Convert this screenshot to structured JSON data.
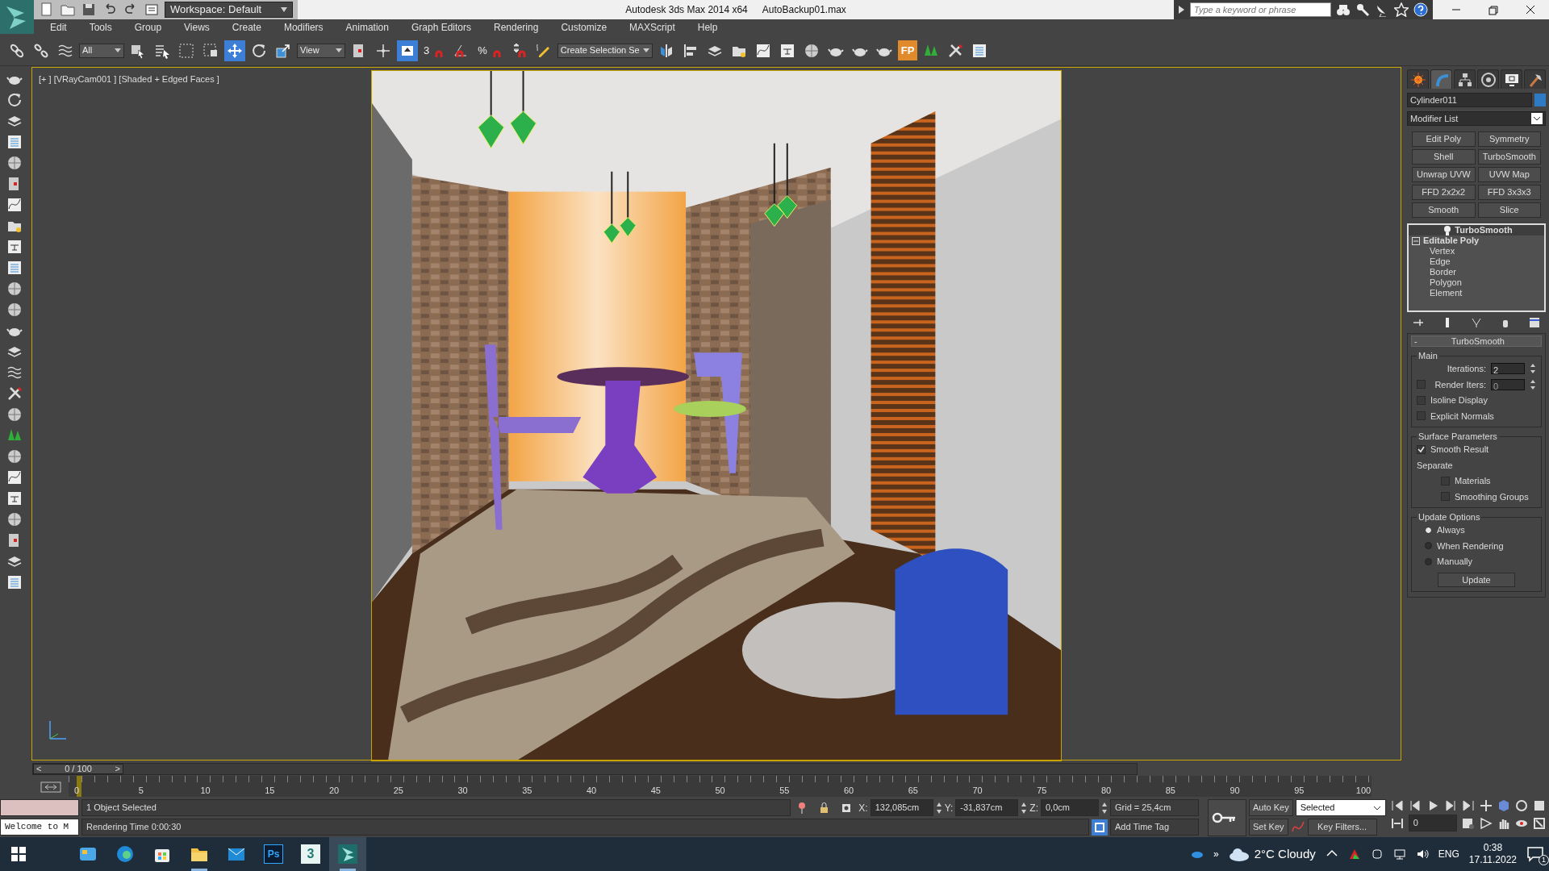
{
  "title_bar": {
    "workspace": "Workspace: Default",
    "app_title": "Autodesk 3ds Max  2014 x64",
    "file_name": "AutoBackup01.max",
    "search": {
      "placeholder": "Type a keyword or phrase"
    }
  },
  "menu": [
    "Edit",
    "Tools",
    "Group",
    "Views",
    "Create",
    "Modifiers",
    "Animation",
    "Graph Editors",
    "Rendering",
    "Customize",
    "MAXScript",
    "Help"
  ],
  "main_toolbar": [
    {
      "kind": "chain",
      "selected": false
    },
    {
      "kind": "broken-chain",
      "selected": false
    },
    {
      "kind": "wave",
      "selected": false
    },
    {
      "kind": "dropdown",
      "value": "All"
    },
    {
      "kind": "cube-cursor",
      "selected": false
    },
    {
      "kind": "list-cursor",
      "selected": false
    },
    {
      "kind": "dashed-rect",
      "selected": false
    },
    {
      "kind": "dashed-cube",
      "selected": false
    },
    {
      "kind": "move",
      "selected": true
    },
    {
      "kind": "rotate",
      "selected": false
    },
    {
      "kind": "scale",
      "selected": false
    },
    {
      "kind": "dropdown",
      "value": "View"
    },
    {
      "kind": "pivot",
      "selected": false
    },
    {
      "kind": "axis-cross",
      "selected": false
    },
    {
      "kind": "manipulate",
      "selected": true
    },
    {
      "kind": "magnet",
      "label": "3",
      "selected": false
    },
    {
      "kind": "angle-magnet",
      "selected": false
    },
    {
      "kind": "magnet",
      "label": "%",
      "selected": false
    },
    {
      "kind": "spinner-magnet",
      "selected": false
    },
    {
      "kind": "pencil",
      "selected": false
    },
    {
      "kind": "dropdown",
      "value": "Create Selection Se"
    },
    {
      "kind": "mirror",
      "selected": false
    },
    {
      "kind": "align",
      "selected": false
    },
    {
      "kind": "layers",
      "selected": false
    },
    {
      "kind": "folder",
      "selected": false
    },
    {
      "kind": "curve",
      "selected": false
    },
    {
      "kind": "schematic",
      "selected": false
    },
    {
      "kind": "sphere",
      "selected": false
    },
    {
      "kind": "teapot",
      "selected": false
    },
    {
      "kind": "teapot",
      "selected": false
    },
    {
      "kind": "teapot",
      "selected": false
    },
    {
      "kind": "badge",
      "label": "FP",
      "selected": false
    },
    {
      "kind": "trees",
      "selected": false
    },
    {
      "kind": "tools",
      "selected": false
    },
    {
      "kind": "list",
      "selected": false
    }
  ],
  "viewport": {
    "label": "[+ ] [VRayCam001 ] [Shaded + Edged Faces ]",
    "active": true
  },
  "command_panel": {
    "tabs": [
      {
        "kind": "create",
        "selected": false
      },
      {
        "kind": "modify",
        "selected": true
      },
      {
        "kind": "hierarchy",
        "selected": false
      },
      {
        "kind": "motion",
        "selected": false
      },
      {
        "kind": "display",
        "selected": false
      },
      {
        "kind": "utilities",
        "selected": false
      }
    ],
    "object_name": "Cylinder011",
    "modifier_list": "Modifier List",
    "modifier_buttons": [
      "Edit Poly",
      "Symmetry",
      "Shell",
      "TurboSmooth",
      "Unwrap UVW",
      "UVW Map",
      "FFD 2x2x2",
      "FFD 3x3x3",
      "Smooth",
      "Slice"
    ],
    "stack": [
      {
        "kind": "modifier",
        "label": "TurboSmooth",
        "selected": true
      },
      {
        "kind": "object",
        "label": "Editable Poly",
        "selected": false,
        "expanded": true,
        "children": [
          {
            "label": "Vertex"
          },
          {
            "label": "Edge"
          },
          {
            "label": "Border"
          },
          {
            "label": "Polygon"
          },
          {
            "label": "Element"
          }
        ]
      }
    ],
    "rollout": {
      "toggle": "-",
      "title": "TurboSmooth",
      "groups": [
        {
          "title": "Main",
          "controls": [
            {
              "kind": "spinner",
              "label": "Iterations:",
              "value": "2"
            },
            {
              "kind": "check-spinner",
              "label": "Render Iters:",
              "checked": false,
              "value": "0"
            },
            {
              "kind": "checkbox",
              "label": "Isoline Display",
              "checked": false
            },
            {
              "kind": "checkbox",
              "label": "Explicit Normals",
              "checked": false
            }
          ]
        },
        {
          "title": "Surface Parameters",
          "controls": [
            {
              "kind": "checkbox",
              "label": "Smooth Result",
              "checked": true
            },
            {
              "kind": "text",
              "label": "Separate"
            },
            {
              "kind": "sub-checkbox",
              "label": "Materials",
              "checked": false
            },
            {
              "kind": "sub-checkbox",
              "label": "Smoothing Groups",
              "checked": false
            }
          ]
        },
        {
          "title": "Update Options",
          "controls": [
            {
              "kind": "radio",
              "label": "Always",
              "selected": true
            },
            {
              "kind": "radio",
              "label": "When Rendering",
              "selected": false
            },
            {
              "kind": "radio",
              "label": "Manually",
              "selected": false
            },
            {
              "kind": "button",
              "label": "Update"
            }
          ]
        }
      ]
    }
  },
  "timeline": {
    "prev": "<",
    "frame": "0 / 100",
    "next": ">",
    "level": 0,
    "ticks": [
      "0",
      "5",
      "10",
      "15",
      "20",
      "25",
      "30",
      "35",
      "40",
      "45",
      "50",
      "55",
      "60",
      "65",
      "70",
      "75",
      "80",
      "85",
      "90",
      "95",
      "100"
    ]
  },
  "status": {
    "listener_text": "Welcome to M",
    "selection": "1 Object Selected",
    "prompt": "Rendering Time  0:00:30",
    "coords": [
      {
        "axis": "X:",
        "value": "132,085cm"
      },
      {
        "axis": "Y:",
        "value": "-31,837cm"
      },
      {
        "axis": "Z:",
        "value": "0,0cm"
      }
    ],
    "grid": "Grid = 25,4cm",
    "add_time_tag": "Add Time Tag",
    "auto_key": "Auto Key",
    "set_key": "Set Key",
    "key_mode": "Selected",
    "key_filters": "Key Filters...",
    "current_frame": "0"
  },
  "taskbar": {
    "apps": [
      {
        "kind": "widgets",
        "running": false,
        "selected": false
      },
      {
        "kind": "edge",
        "running": false,
        "selected": false
      },
      {
        "kind": "store",
        "running": false,
        "selected": false
      },
      {
        "kind": "explorer",
        "running": true,
        "selected": false
      },
      {
        "kind": "mail",
        "running": false,
        "selected": false
      },
      {
        "kind": "photoshop",
        "label": "Ps",
        "running": false,
        "selected": false
      },
      {
        "kind": "max-old",
        "label": "3",
        "running": false,
        "selected": false
      },
      {
        "kind": "max",
        "running": true,
        "selected": true
      }
    ],
    "overflow": "»",
    "weather": "2°C  Cloudy",
    "language": "ENG",
    "time": "0:38",
    "date": "17.11.2022",
    "notifications": "1"
  }
}
